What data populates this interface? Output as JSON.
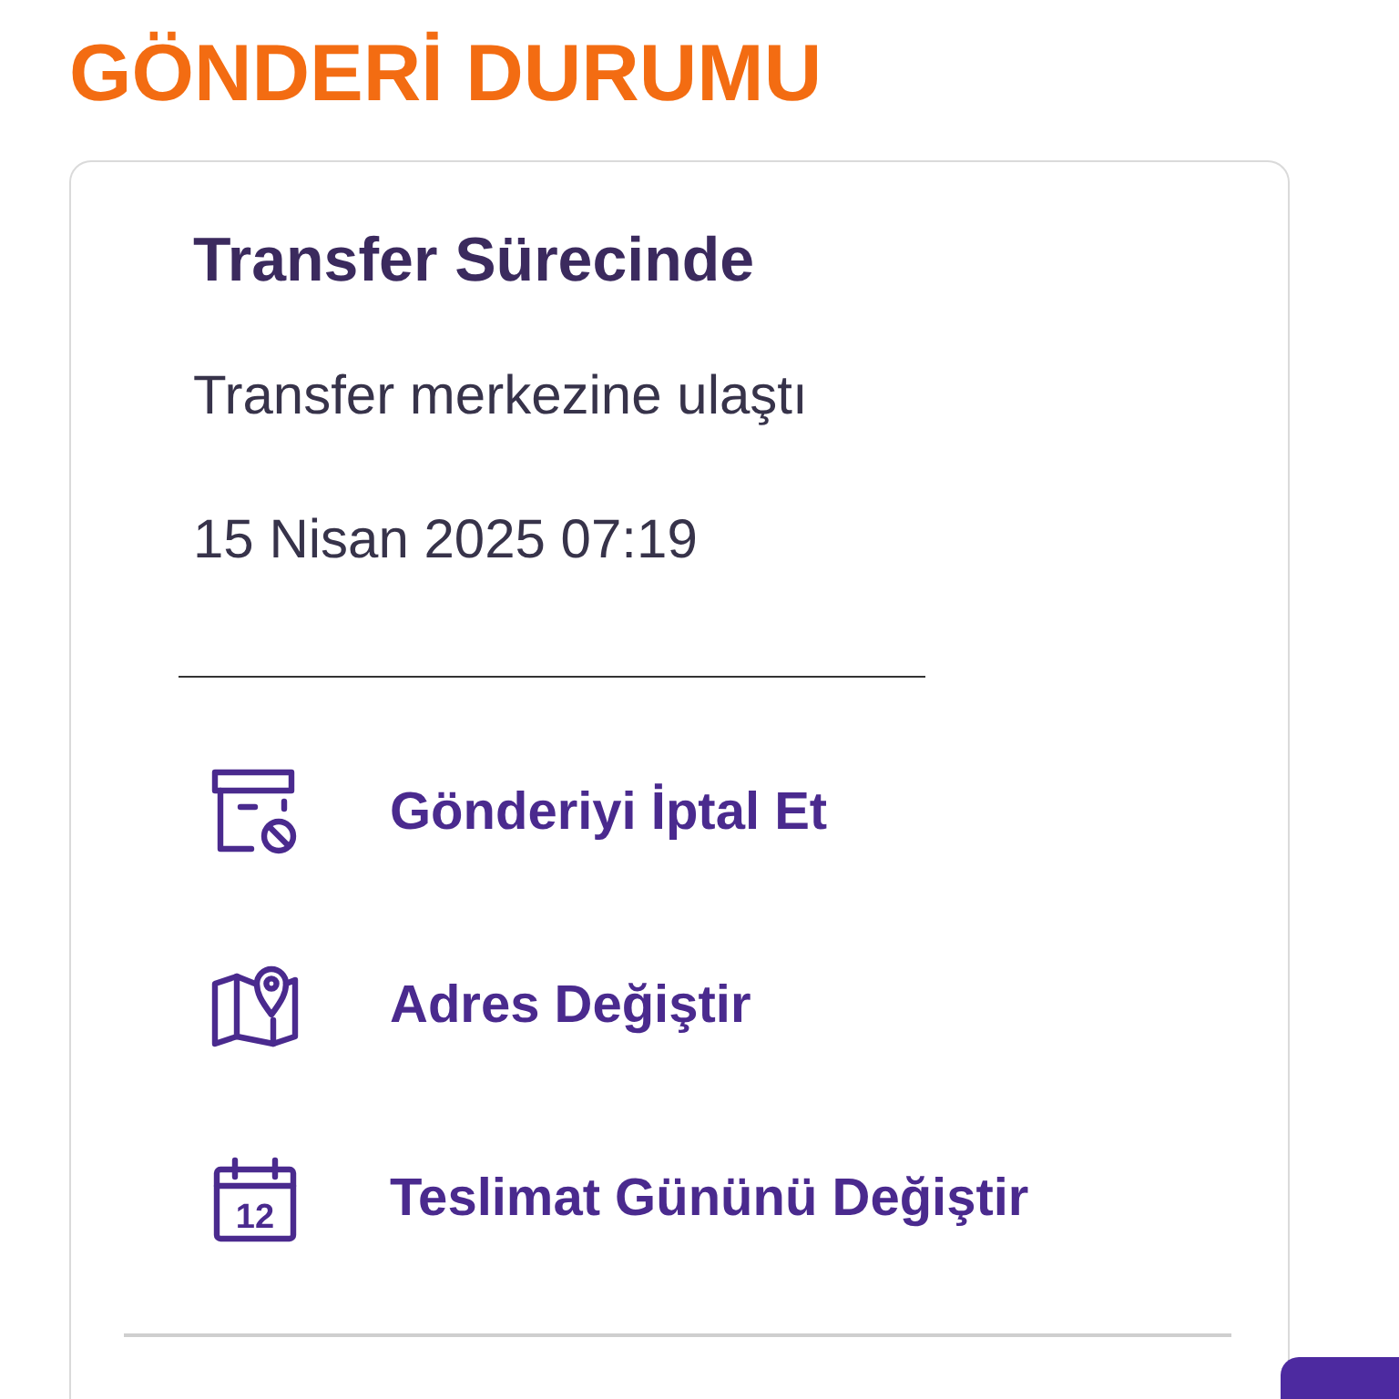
{
  "heading": "GÖNDERİ DURUMU",
  "status": {
    "title": "Transfer Sürecinde",
    "description": "Transfer merkezine ulaştı",
    "timestamp": "15 Nisan 2025 07:19"
  },
  "actions": [
    {
      "kind": "cancel",
      "label": "Gönderiyi İptal Et"
    },
    {
      "kind": "address",
      "label": "Adres Değiştir"
    },
    {
      "kind": "calendar",
      "label": "Teslimat Gününü Değiştir",
      "icon_text": "12"
    }
  ]
}
